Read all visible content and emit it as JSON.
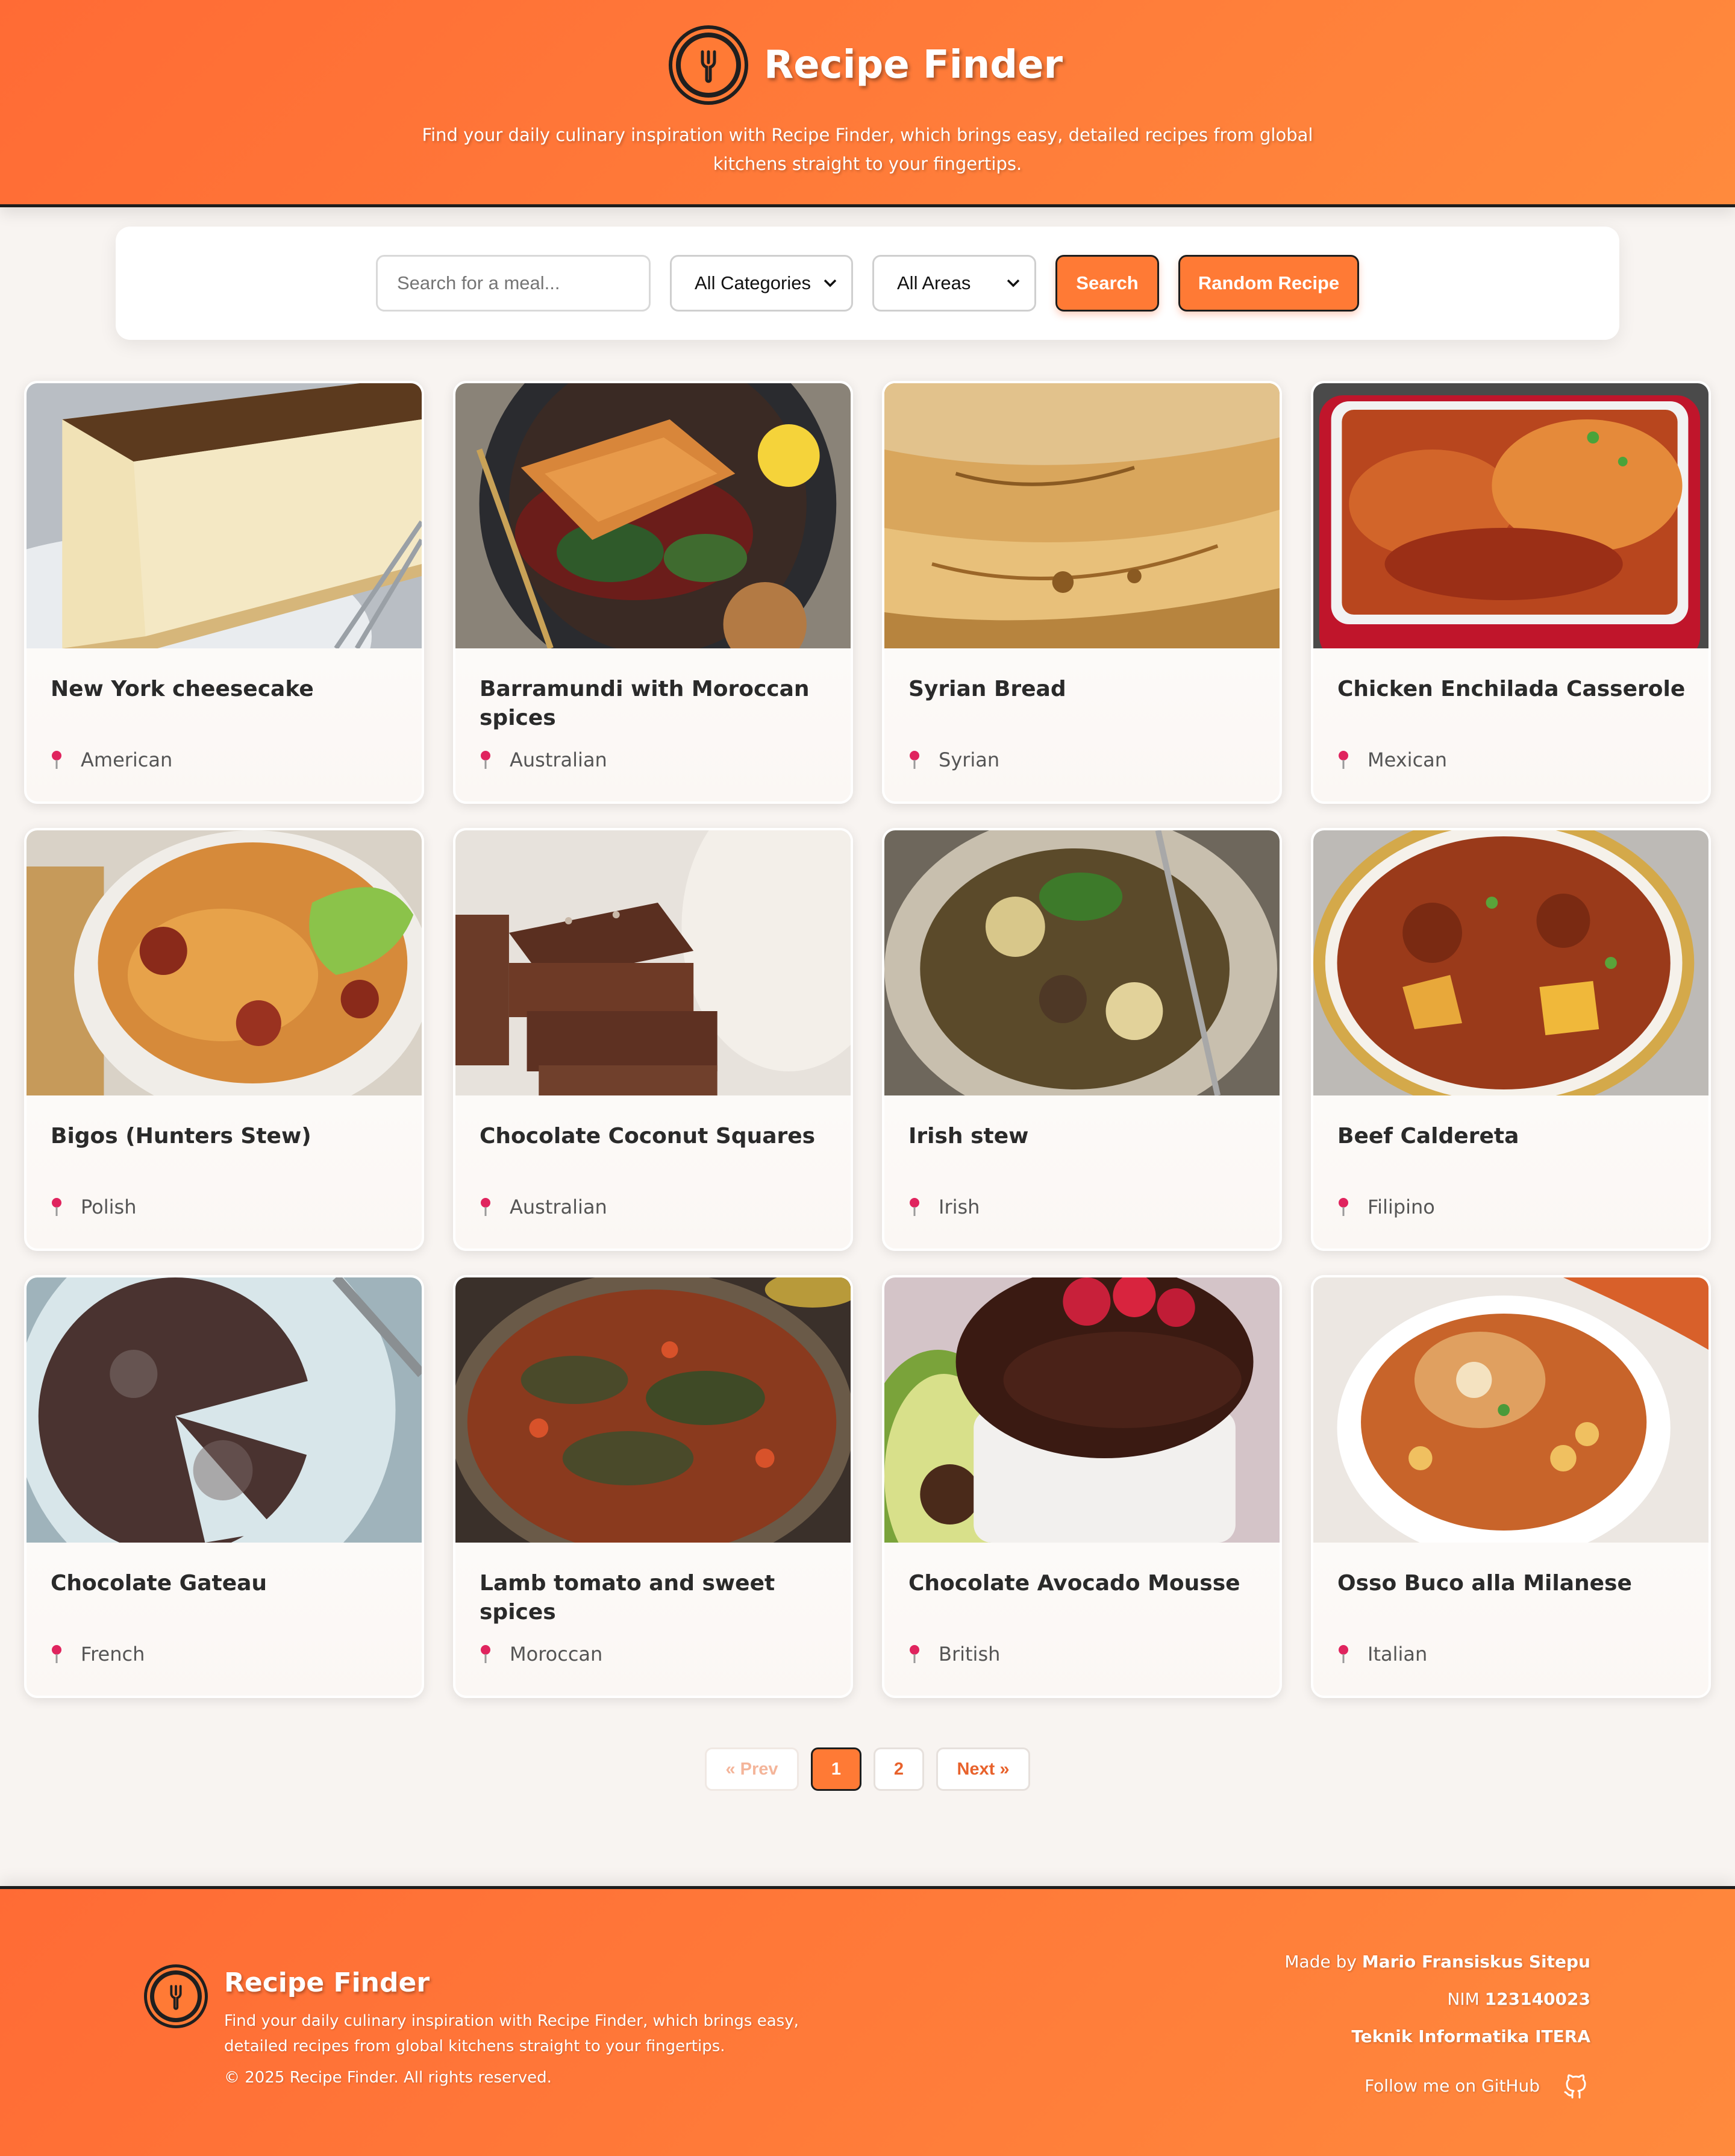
{
  "header": {
    "title": "Recipe Finder",
    "tagline": "Find your daily culinary inspiration with Recipe Finder, which brings easy, detailed recipes from global kitchens straight to your fingertips."
  },
  "search": {
    "placeholder": "Search for a meal...",
    "value": "",
    "category_selected": "All Categories",
    "area_selected": "All Areas",
    "search_label": "Search",
    "random_label": "Random Recipe"
  },
  "meals": [
    {
      "name": "New York cheesecake",
      "area": "American",
      "image": "cheesecake"
    },
    {
      "name": "Barramundi with Moroccan spices",
      "area": "Australian",
      "image": "fish-plate"
    },
    {
      "name": "Syrian Bread",
      "area": "Syrian",
      "image": "flatbread"
    },
    {
      "name": "Chicken Enchilada Casserole",
      "area": "Mexican",
      "image": "casserole"
    },
    {
      "name": "Bigos (Hunters Stew)",
      "area": "Polish",
      "image": "stew-bowl"
    },
    {
      "name": "Chocolate Coconut Squares",
      "area": "Australian",
      "image": "chocolate-squares"
    },
    {
      "name": "Irish stew",
      "area": "Irish",
      "image": "irish-stew"
    },
    {
      "name": "Beef Caldereta",
      "area": "Filipino",
      "image": "beef-stew"
    },
    {
      "name": "Chocolate Gateau",
      "area": "French",
      "image": "chocolate-cake"
    },
    {
      "name": "Lamb tomato and sweet spices",
      "area": "Moroccan",
      "image": "lamb-dish"
    },
    {
      "name": "Chocolate Avocado Mousse",
      "area": "British",
      "image": "mousse"
    },
    {
      "name": "Osso Buco alla Milanese",
      "area": "Italian",
      "image": "osso-buco"
    }
  ],
  "pagination": {
    "prev": "« Prev",
    "pages": [
      "1",
      "2"
    ],
    "active": "1",
    "next": "Next »"
  },
  "footer": {
    "title": "Recipe Finder",
    "description": "Find your daily culinary inspiration with Recipe Finder, which brings easy, detailed recipes from global kitchens straight to your fingertips.",
    "copyright": "© 2025 Recipe Finder. All rights reserved.",
    "made_by_prefix": "Made by ",
    "author": "Mario Fransiskus Sitepu",
    "nim_prefix": "NIM ",
    "nim": "123140023",
    "institution": "Teknik Informatika ITERA",
    "github_label": "Follow me on GitHub"
  },
  "colors": {
    "accent": "#ff7a35",
    "accent_dark": "#ff6b35",
    "background": "#f8f4f1",
    "pin": "#e0245e"
  },
  "icons": {
    "logo": "fork-icon",
    "location": "pin-icon",
    "github": "github-icon",
    "select": "chevron-down-icon"
  }
}
